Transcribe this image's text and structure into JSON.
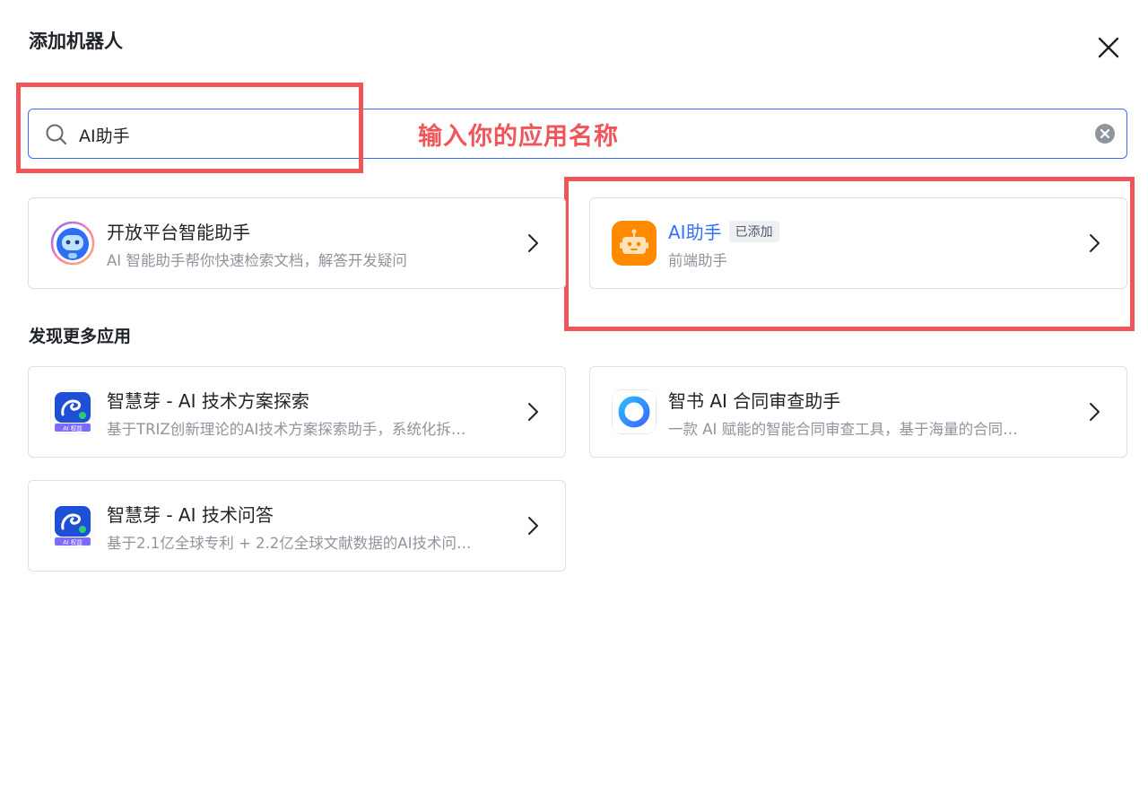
{
  "dialog": {
    "title": "添加机器人",
    "close_icon": "close-icon"
  },
  "search": {
    "value": "AI助手",
    "icon": "search-icon",
    "clear_icon": "clear-circle-icon"
  },
  "annotation": {
    "text": "输入你的应用名称",
    "color": "#f0555a"
  },
  "results": [
    {
      "name": "开放平台智能助手",
      "desc": "AI 智能助手帮你快速检索文档，解答开发疑问",
      "icon": "blue-robot-avatar"
    },
    {
      "name": "AI助手",
      "tag": "已添加",
      "desc": "前端助手",
      "icon": "orange-robot-avatar"
    }
  ],
  "section": {
    "title": "发现更多应用"
  },
  "apps": [
    {
      "name": "智慧芽 - AI 技术方案探索",
      "desc": "基于TRIZ创新理论的AI技术方案探索助手，系统化拆…",
      "badge": "AI 权益",
      "icon": "zhihuiya-logo"
    },
    {
      "name": "智书 AI 合同审查助手",
      "desc": "一款 AI 赋能的智能合同审查工具，基于海量的合同…",
      "icon": "ring-logo"
    },
    {
      "name": "智慧芽 - AI 技术问答",
      "desc": "基于2.1亿全球专利 + 2.2亿全球文献数据的AI技术问…",
      "badge": "AI 权益",
      "icon": "zhihuiya-logo"
    }
  ],
  "colors": {
    "accent": "#3370ff",
    "annotation": "#f0555a",
    "border": "#dee0e3"
  }
}
